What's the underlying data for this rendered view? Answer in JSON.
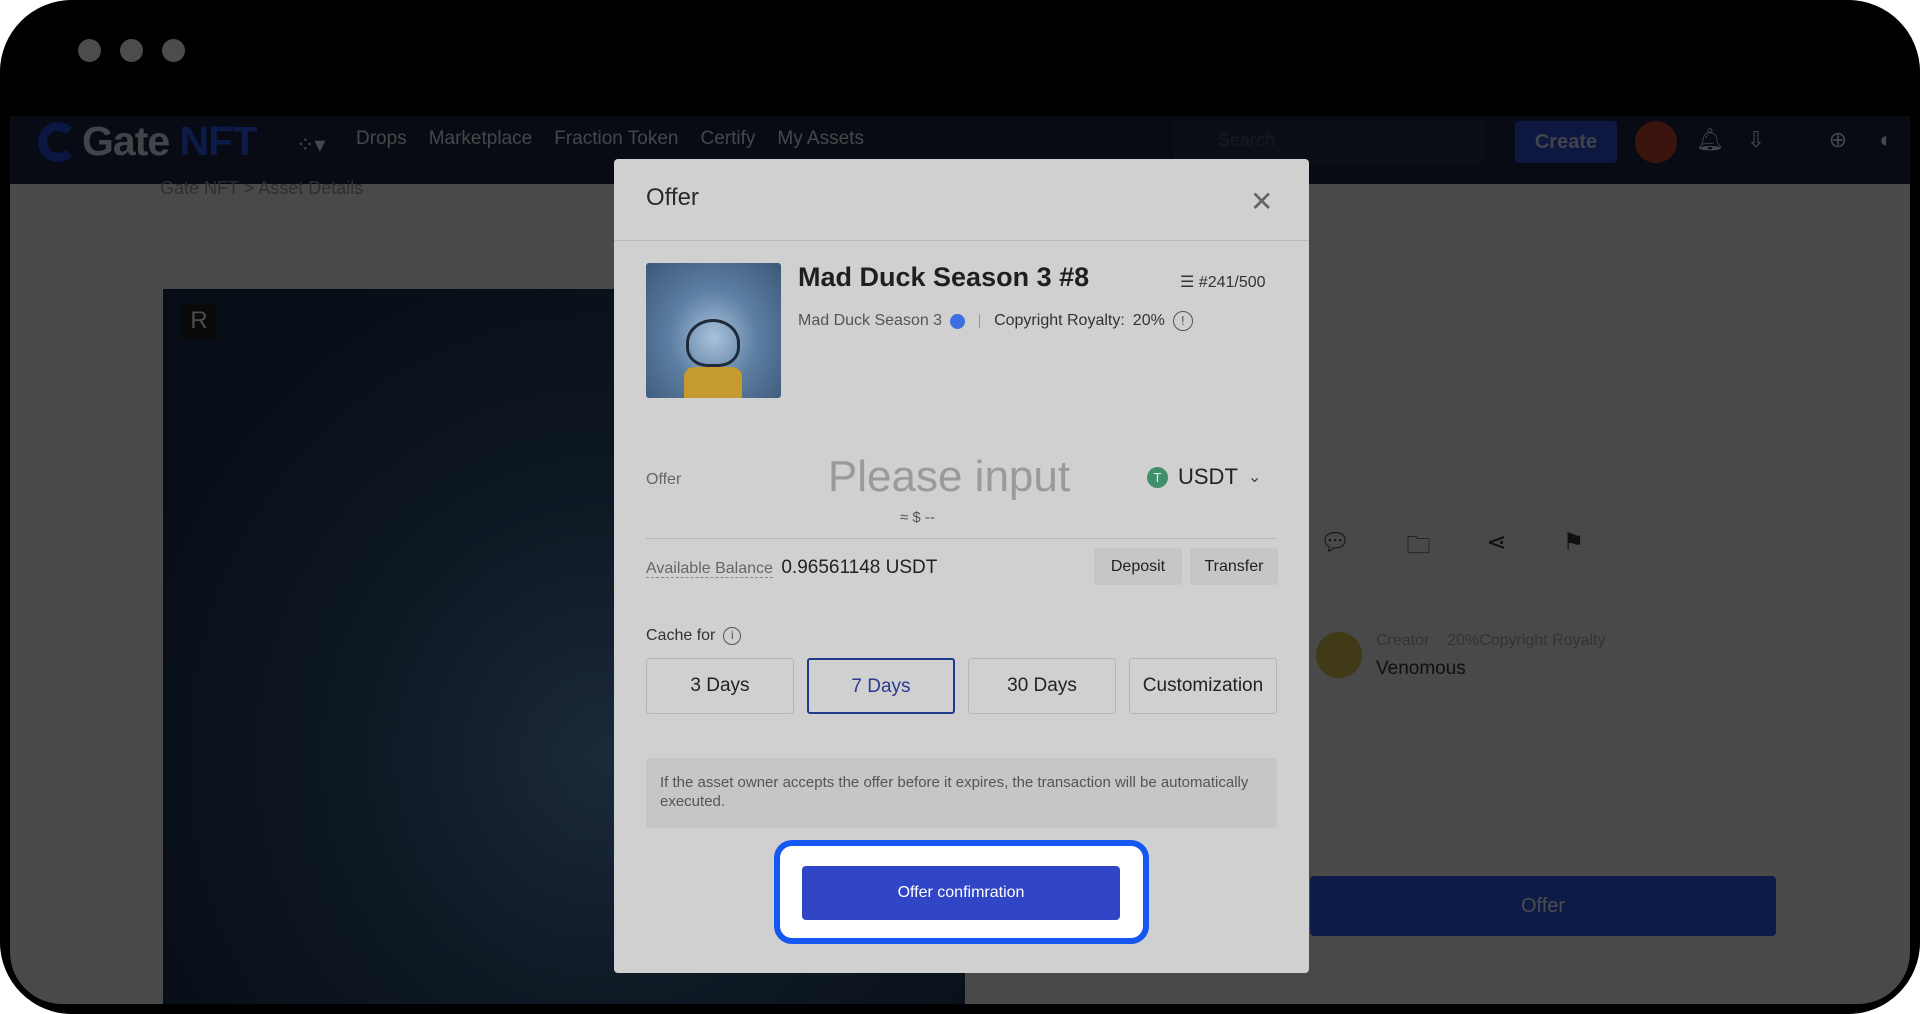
{
  "nav": {
    "logo": "Gate",
    "logo_accent": "NFT",
    "links": [
      "Drops",
      "Marketplace",
      "Fraction Token",
      "Certify",
      "My Assets"
    ],
    "search_placeholder": "Search",
    "create_label": "Create"
  },
  "page": {
    "breadcrumb": "Gate NFT > Asset Details",
    "art_badge": "R",
    "creator_label": "Creator",
    "creator_royalty": "20%Copyright Royalty",
    "creator_name": "Venomous",
    "offer_button": "Offer"
  },
  "modal": {
    "title": "Offer",
    "asset_name": "Mad Duck Season 3 #8",
    "edition": "#241/500",
    "collection": "Mad Duck Season 3",
    "royalty_label": "Copyright Royalty:",
    "royalty_value": "20%",
    "offer_label": "Offer",
    "offer_placeholder": "Please input",
    "usd_approx": "≈ $ --",
    "currency": "USDT",
    "balance_label": "Available Balance",
    "balance_value": "0.96561148 USDT",
    "deposit_label": "Deposit",
    "transfer_label": "Transfer",
    "cache_label": "Cache for",
    "cache_options": [
      "3 Days",
      "7 Days",
      "30 Days",
      "Customization"
    ],
    "cache_selected": "7 Days",
    "notice": "If the asset owner accepts the offer before it expires, the transaction will be automatically executed.",
    "confirm_label": "Offer confimration"
  },
  "colors": {
    "accent": "#3146c6",
    "highlight": "#1557f2",
    "usdt": "#3f8f6b"
  }
}
